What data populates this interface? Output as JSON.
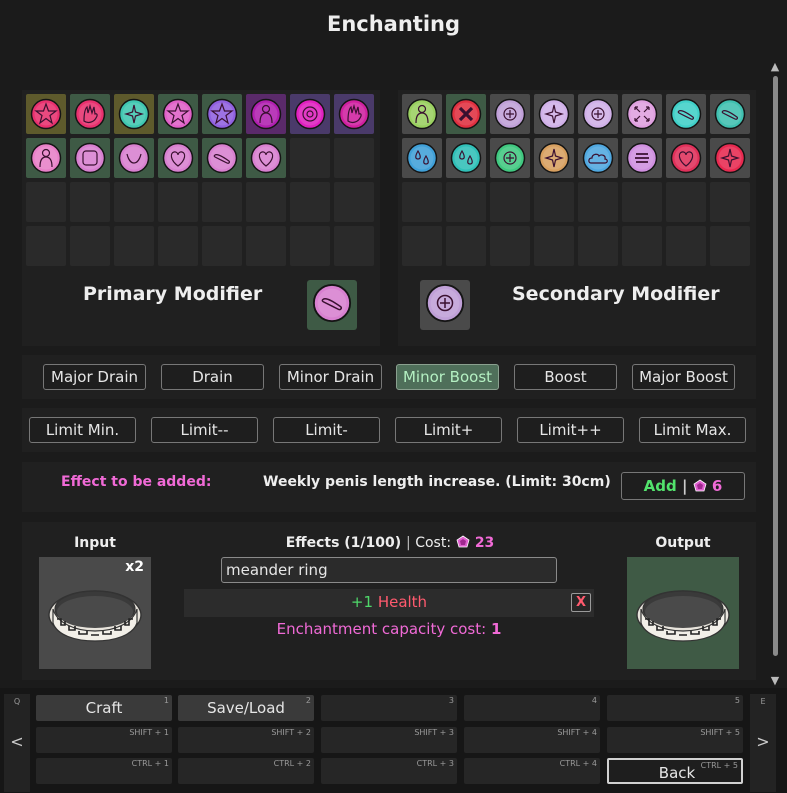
{
  "title": "Enchanting",
  "primary": {
    "title": "Primary Modifier",
    "icons": [
      {
        "name": "pink-star-bubble-icon",
        "bg": "#5e5a2c",
        "fg": "#e8306e",
        "glyph": "star"
      },
      {
        "name": "pink-hand-orb-icon",
        "bg": "#3e5a45",
        "fg": "#e8306e",
        "glyph": "hand"
      },
      {
        "name": "teal-sparkle-orb-icon",
        "bg": "#5e5a2c",
        "fg": "#3fc6b0",
        "glyph": "spark"
      },
      {
        "name": "pink-star-orb-icon",
        "bg": "#3e5a45",
        "fg": "#e060c8",
        "glyph": "star"
      },
      {
        "name": "violet-star-orb-icon",
        "bg": "#3e5a45",
        "fg": "#9060e0",
        "glyph": "star"
      },
      {
        "name": "purple-figure-orb-icon",
        "bg": "#5a2a6a",
        "fg": "#b020b0",
        "glyph": "figure"
      },
      {
        "name": "magenta-ring-orb-icon",
        "bg": "#4a3a6a",
        "fg": "#e020c0",
        "glyph": "ring"
      },
      {
        "name": "magenta-hand-orb-icon",
        "bg": "#4a3a6a",
        "fg": "#d020a0",
        "glyph": "hand"
      },
      {
        "name": "pink-lady-orb-icon",
        "bg": "#3e5a45",
        "fg": "#e880c8",
        "glyph": "figure"
      },
      {
        "name": "pink-body-orb-icon",
        "bg": "#3e5a45",
        "fg": "#d880d0",
        "glyph": "square"
      },
      {
        "name": "pink-belly-orb-icon",
        "bg": "#3e5a45",
        "fg": "#d880d0",
        "glyph": "circle"
      },
      {
        "name": "pink-chest-orb-icon",
        "bg": "#3e5a45",
        "fg": "#d880d0",
        "glyph": "heart"
      },
      {
        "name": "pink-length-orb-icon",
        "bg": "#3e5a45",
        "fg": "#d880d0",
        "glyph": "bar"
      },
      {
        "name": "pink-girth-orb-icon",
        "bg": "#3e5a45",
        "fg": "#d880d0",
        "glyph": "heart"
      }
    ],
    "selected_icon": {
      "name": "selected-length-icon",
      "bg": "#3e5a45",
      "fg": "#d880d0",
      "glyph": "bar"
    }
  },
  "secondary": {
    "title": "Secondary Modifier",
    "icons": [
      {
        "name": "green-figure-orb-icon",
        "bg": "#4a4a4a",
        "fg": "#9ad060",
        "glyph": "figure"
      },
      {
        "name": "red-cross-orb-icon",
        "bg": "#3e5a45",
        "fg": "#e03040",
        "glyph": "cross"
      },
      {
        "name": "lilac-plus-orb-icon",
        "bg": "#4a4a4a",
        "fg": "#c0a0d8",
        "glyph": "plus"
      },
      {
        "name": "lilac-sparkle-orb-icon",
        "bg": "#4a4a4a",
        "fg": "#d0b0e8",
        "glyph": "spark"
      },
      {
        "name": "lilac-cross-orb-icon",
        "bg": "#4a4a4a",
        "fg": "#d0b0e8",
        "glyph": "plus"
      },
      {
        "name": "lilac-arrows-orb-icon",
        "bg": "#4a4a4a",
        "fg": "#e0a0e0",
        "glyph": "arrows"
      },
      {
        "name": "teal-comb-orb-icon",
        "bg": "#4a4a4a",
        "fg": "#40d0c8",
        "glyph": "bar"
      },
      {
        "name": "teal-tail-orb-icon",
        "bg": "#4a4a4a",
        "fg": "#40c0b0",
        "glyph": "bar"
      },
      {
        "name": "blue-drops-orb-icon",
        "bg": "#4a4a4a",
        "fg": "#40a0d8",
        "glyph": "drops"
      },
      {
        "name": "teal-splash-orb-icon",
        "bg": "#4a4a4a",
        "fg": "#30c0b8",
        "glyph": "drops"
      },
      {
        "name": "green-plus-orb-icon",
        "bg": "#4a4a4a",
        "fg": "#40c880",
        "glyph": "plus"
      },
      {
        "name": "tan-hair-orb-icon",
        "bg": "#4a4a4a",
        "fg": "#d8a060",
        "glyph": "spark"
      },
      {
        "name": "blue-cloud-orb-icon",
        "bg": "#4a4a4a",
        "fg": "#50a8e0",
        "glyph": "cloud"
      },
      {
        "name": "violet-lines-orb-icon",
        "bg": "#4a4a4a",
        "fg": "#d090e0",
        "glyph": "lines"
      },
      {
        "name": "crimson-lips-orb-icon",
        "bg": "#4a4a4a",
        "fg": "#e0305a",
        "glyph": "heart"
      },
      {
        "name": "red-fire-orb-icon",
        "bg": "#4a4a4a",
        "fg": "#e82a50",
        "glyph": "spark"
      }
    ],
    "selected_icon": {
      "name": "selected-plus-icon",
      "bg": "#4a4a4a",
      "fg": "#c0a0d8",
      "glyph": "plus"
    }
  },
  "potency_buttons": [
    {
      "label": "Major Drain",
      "active": false,
      "name": "major-drain-button"
    },
    {
      "label": "Drain",
      "active": false,
      "name": "drain-button"
    },
    {
      "label": "Minor Drain",
      "active": false,
      "name": "minor-drain-button"
    },
    {
      "label": "Minor Boost",
      "active": true,
      "name": "minor-boost-button"
    },
    {
      "label": "Boost",
      "active": false,
      "name": "boost-button"
    },
    {
      "label": "Major Boost",
      "active": false,
      "name": "major-boost-button"
    }
  ],
  "limit_buttons": [
    {
      "label": "Limit Min.",
      "name": "limit-min-button"
    },
    {
      "label": "Limit--",
      "name": "limit-minus-minus-button"
    },
    {
      "label": "Limit-",
      "name": "limit-minus-button"
    },
    {
      "label": "Limit+",
      "name": "limit-plus-button"
    },
    {
      "label": "Limit++",
      "name": "limit-plus-plus-button"
    },
    {
      "label": "Limit Max.",
      "name": "limit-max-button"
    }
  ],
  "effect_to_add": {
    "label": "Effect to be added:",
    "description": "Weekly penis length increase. (Limit: 30cm)",
    "add_label": "Add",
    "separator": "|",
    "cost": "6"
  },
  "craft": {
    "input_label": "Input",
    "input_count": "x2",
    "output_label": "Output",
    "effects_label": "Effects (1/100)",
    "cost_label": "Cost:",
    "cost_value": "23",
    "search_value": "meander ring",
    "effect_value": "+1",
    "effect_name": "Health",
    "remove_label": "X",
    "capacity_label": "Enchantment capacity cost:",
    "capacity_value": "1"
  },
  "colors": {
    "accent_pink": "#f06ad6",
    "accent_green": "#52e36c",
    "health_red": "#ff5a6e",
    "heal_green": "#4fd86a"
  },
  "hotbar": {
    "left_key": "Q",
    "left_arrow": "<",
    "right_key": "E",
    "right_arrow": ">",
    "rows": [
      [
        {
          "label": "Craft",
          "key": "1"
        },
        {
          "label": "Save/Load",
          "key": "2"
        },
        {
          "label": "",
          "key": "3"
        },
        {
          "label": "",
          "key": "4"
        },
        {
          "label": "",
          "key": "5"
        }
      ],
      [
        {
          "label": "",
          "key": "SHIFT + 1"
        },
        {
          "label": "",
          "key": "SHIFT + 2"
        },
        {
          "label": "",
          "key": "SHIFT + 3"
        },
        {
          "label": "",
          "key": "SHIFT + 4"
        },
        {
          "label": "",
          "key": "SHIFT + 5"
        }
      ],
      [
        {
          "label": "",
          "key": "CTRL + 1"
        },
        {
          "label": "",
          "key": "CTRL + 2"
        },
        {
          "label": "",
          "key": "CTRL + 3"
        },
        {
          "label": "",
          "key": "CTRL + 4"
        },
        {
          "label": "Back",
          "key": "CTRL + 5"
        }
      ]
    ]
  }
}
